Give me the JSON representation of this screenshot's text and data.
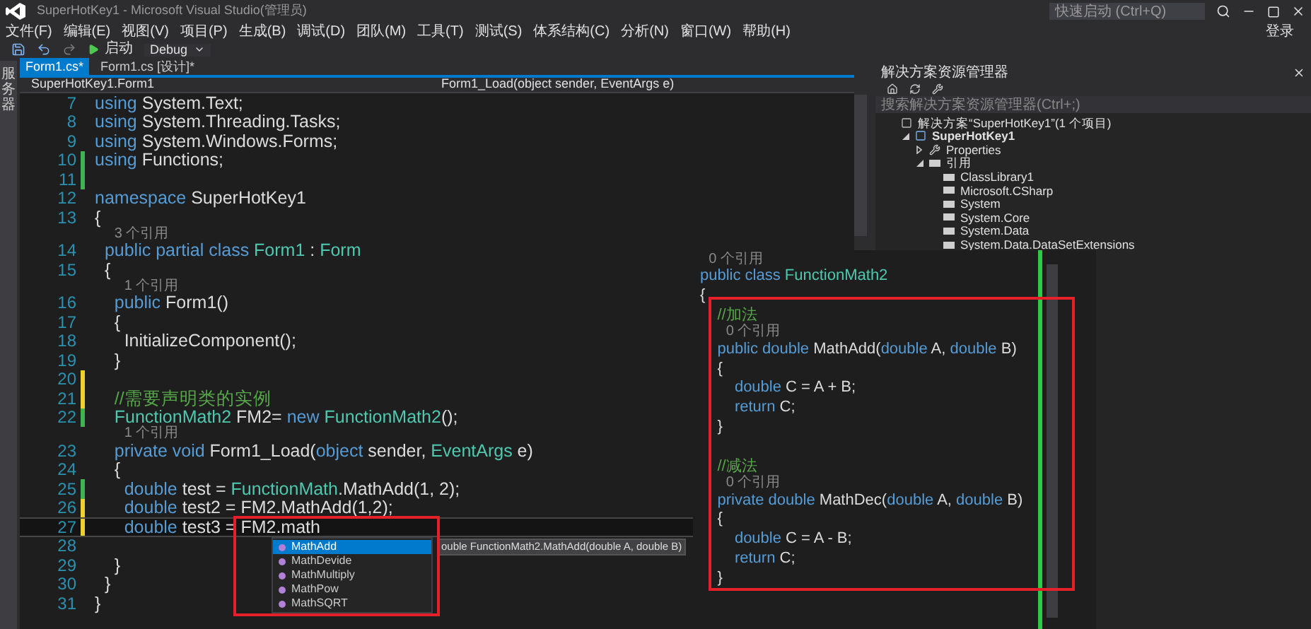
{
  "window": {
    "title": "SuperHotKey1 - Microsoft Visual Studio(管理员)",
    "login": "登录"
  },
  "quick_launch": {
    "placeholder": "快速启动 (Ctrl+Q)"
  },
  "menu": [
    "文件(F)",
    "编辑(E)",
    "视图(V)",
    "项目(P)",
    "生成(B)",
    "调试(D)",
    "团队(M)",
    "工具(T)",
    "测试(S)",
    "体系结构(C)",
    "分析(N)",
    "窗口(W)",
    "帮助(H)"
  ],
  "toolbar": {
    "start": "启动",
    "configuration": "Debug"
  },
  "side_tab": "服务器",
  "tabs": [
    {
      "label": "Form1.cs*",
      "selected": true
    },
    {
      "label": "Form1.cs [设计]*",
      "selected": false
    }
  ],
  "navigation": {
    "type": "SuperHotKey1.Form1",
    "member": "Form1_Load(object sender, EventArgs e)"
  },
  "code": [
    {
      "num": "7",
      "tokens": [
        {
          "text": "using",
          "kind": "keyword"
        },
        {
          "text": " System.Text;",
          "kind": "plain"
        }
      ]
    },
    {
      "num": "8",
      "tokens": [
        {
          "text": "using",
          "kind": "keyword"
        },
        {
          "text": " System.Threading.Tasks;",
          "kind": "plain"
        }
      ]
    },
    {
      "num": "9",
      "tokens": [
        {
          "text": "using",
          "kind": "keyword"
        },
        {
          "text": " System.Windows.Forms;",
          "kind": "plain"
        }
      ]
    },
    {
      "num": "10",
      "saved_change": true,
      "tokens": [
        {
          "text": "using",
          "kind": "keyword"
        },
        {
          "text": " Functions;",
          "kind": "plain"
        }
      ]
    },
    {
      "num": "11",
      "saved_change": true
    },
    {
      "num": "12",
      "tokens": [
        {
          "text": "namespace",
          "kind": "keyword"
        },
        {
          "text": " SuperHotKey1",
          "kind": "plain"
        }
      ]
    },
    {
      "num": "13",
      "tokens": [
        {
          "text": "{",
          "kind": "plain"
        }
      ]
    },
    {
      "num": "14",
      "hint": "3 个引用",
      "tokens": [
        {
          "text": "  public partial class",
          "kind": "keyword"
        },
        {
          "text": " Form1",
          "kind": "type"
        },
        {
          "text": " : ",
          "kind": "plain"
        },
        {
          "text": "Form",
          "kind": "type"
        }
      ]
    },
    {
      "num": "15",
      "tokens": [
        {
          "text": "  {",
          "kind": "plain"
        }
      ]
    },
    {
      "num": "16",
      "hint": "1 个引用",
      "tokens": [
        {
          "text": "    public",
          "kind": "keyword"
        },
        {
          "text": " Form1()",
          "kind": "plain"
        }
      ]
    },
    {
      "num": "17",
      "tokens": [
        {
          "text": "    {",
          "kind": "plain"
        }
      ]
    },
    {
      "num": "18",
      "tokens": [
        {
          "text": "      InitializeComponent();",
          "kind": "plain"
        }
      ]
    },
    {
      "num": "19",
      "tokens": [
        {
          "text": "    }",
          "kind": "plain"
        }
      ]
    },
    {
      "num": "20",
      "unsaved_change": true
    },
    {
      "num": "21",
      "unsaved_change": true,
      "tokens": [
        {
          "text": "    //需要声明类的实例",
          "kind": "comment"
        }
      ]
    },
    {
      "num": "22",
      "saved_change": true,
      "tokens": [
        {
          "text": "    FunctionMath2",
          "kind": "type"
        },
        {
          "text": " FM2= ",
          "kind": "plain"
        },
        {
          "text": "new",
          "kind": "keyword"
        },
        {
          "text": " FunctionMath2",
          "kind": "type"
        },
        {
          "text": "();",
          "kind": "plain"
        }
      ]
    },
    {
      "num": "23",
      "hint": "1 个引用",
      "tokens": [
        {
          "text": "    private void",
          "kind": "keyword"
        },
        {
          "text": " Form1_Load(",
          "kind": "plain"
        },
        {
          "text": "object",
          "kind": "keyword"
        },
        {
          "text": " sender, ",
          "kind": "plain"
        },
        {
          "text": "EventArgs",
          "kind": "type"
        },
        {
          "text": " e)",
          "kind": "plain"
        }
      ]
    },
    {
      "num": "24",
      "tokens": [
        {
          "text": "    {",
          "kind": "plain"
        }
      ]
    },
    {
      "num": "25",
      "saved_change": true,
      "tokens": [
        {
          "text": "      double",
          "kind": "keyword"
        },
        {
          "text": " test = ",
          "kind": "plain"
        },
        {
          "text": "FunctionMath",
          "kind": "type"
        },
        {
          "text": ".MathAdd(1, 2);",
          "kind": "plain"
        }
      ]
    },
    {
      "num": "26",
      "unsaved_change": true,
      "tokens": [
        {
          "text": "      double",
          "kind": "keyword"
        },
        {
          "text": " test2 = FM2.MathAdd(1,2);",
          "kind": "plain"
        }
      ]
    },
    {
      "num": "27",
      "unsaved_change": true,
      "current": true,
      "tokens": [
        {
          "text": "      double",
          "kind": "keyword"
        },
        {
          "text": " test3 = FM2.math",
          "kind": "plain"
        }
      ]
    },
    {
      "num": "28"
    },
    {
      "num": "29",
      "tokens": [
        {
          "text": "    }",
          "kind": "plain"
        }
      ]
    },
    {
      "num": "30",
      "tokens": [
        {
          "text": "  }",
          "kind": "plain"
        }
      ]
    },
    {
      "num": "31",
      "tokens": [
        {
          "text": "}",
          "kind": "plain"
        }
      ]
    }
  ],
  "completion": {
    "items": [
      {
        "label": "MathAdd",
        "selected": true
      },
      {
        "label": "MathDevide",
        "selected": false
      },
      {
        "label": "MathMultiply",
        "selected": false
      },
      {
        "label": "MathPow",
        "selected": false
      },
      {
        "label": "MathSQRT",
        "selected": false
      }
    ],
    "tooltip": "ouble FunctionMath2.MathAdd(double A, double B)"
  },
  "peek": {
    "class_lines": [
      {
        "hint": "0 个引用",
        "tokens": [
          {
            "text": "public class",
            "kind": "keyword"
          },
          {
            "text": " FunctionMath2",
            "kind": "type"
          }
        ]
      },
      {
        "tokens": [
          {
            "text": "{",
            "kind": "plain"
          }
        ]
      }
    ],
    "methods": [
      {
        "lines": [
          {
            "tokens": [
              {
                "text": "    //加法",
                "kind": "comment"
              }
            ]
          },
          {
            "hint": "0 个引用",
            "tokens": [
              {
                "text": "    public double",
                "kind": "keyword"
              },
              {
                "text": " MathAdd(",
                "kind": "plain"
              },
              {
                "text": "double",
                "kind": "keyword"
              },
              {
                "text": " A, ",
                "kind": "plain"
              },
              {
                "text": "double",
                "kind": "keyword"
              },
              {
                "text": " B)",
                "kind": "plain"
              }
            ]
          },
          {
            "tokens": [
              {
                "text": "    {",
                "kind": "plain"
              }
            ]
          },
          {
            "tokens": [
              {
                "text": "        double",
                "kind": "keyword"
              },
              {
                "text": " C = A + B;",
                "kind": "plain"
              }
            ]
          },
          {
            "tokens": [
              {
                "text": "        return",
                "kind": "keyword"
              },
              {
                "text": " C;",
                "kind": "plain"
              }
            ]
          },
          {
            "tokens": [
              {
                "text": "    }",
                "kind": "plain"
              }
            ]
          }
        ]
      },
      {
        "lines": [
          {
            "tokens": [
              {
                "text": "    //减法",
                "kind": "comment"
              }
            ]
          },
          {
            "hint": "0 个引用",
            "tokens": [
              {
                "text": "    private double",
                "kind": "keyword"
              },
              {
                "text": " MathDec(",
                "kind": "plain"
              },
              {
                "text": "double",
                "kind": "keyword"
              },
              {
                "text": " A, ",
                "kind": "plain"
              },
              {
                "text": "double",
                "kind": "keyword"
              },
              {
                "text": " B)",
                "kind": "plain"
              }
            ]
          },
          {
            "tokens": [
              {
                "text": "    {",
                "kind": "plain"
              }
            ]
          },
          {
            "tokens": [
              {
                "text": "        double",
                "kind": "keyword"
              },
              {
                "text": " C = A - B;",
                "kind": "plain"
              }
            ]
          },
          {
            "tokens": [
              {
                "text": "        return",
                "kind": "keyword"
              },
              {
                "text": " C;",
                "kind": "plain"
              }
            ]
          },
          {
            "tokens": [
              {
                "text": "    }",
                "kind": "plain"
              }
            ]
          }
        ]
      }
    ]
  },
  "solution_explorer": {
    "title": "解决方案资源管理器",
    "search": {
      "placeholder": "搜索解决方案资源管理器(Ctrl+;)"
    },
    "tree": [
      {
        "label": "解决方案“SuperHotKey1”(1 个项目)",
        "kind": "solution",
        "children": [
          {
            "label": "SuperHotKey1",
            "kind": "project",
            "expanded": true,
            "children": [
              {
                "label": "Properties",
                "kind": "properties",
                "expanded": false
              },
              {
                "label": "引用",
                "kind": "references",
                "expanded": true,
                "children": [
                  {
                    "label": "ClassLibrary1",
                    "kind": "reference"
                  },
                  {
                    "label": "Microsoft.CSharp",
                    "kind": "reference"
                  },
                  {
                    "label": "System",
                    "kind": "reference"
                  },
                  {
                    "label": "System.Core",
                    "kind": "reference"
                  },
                  {
                    "label": "System.Data",
                    "kind": "reference"
                  },
                  {
                    "label": "System.Data.DataSetExtensions",
                    "kind": "reference"
                  }
                ]
              }
            ]
          }
        ]
      }
    ]
  }
}
